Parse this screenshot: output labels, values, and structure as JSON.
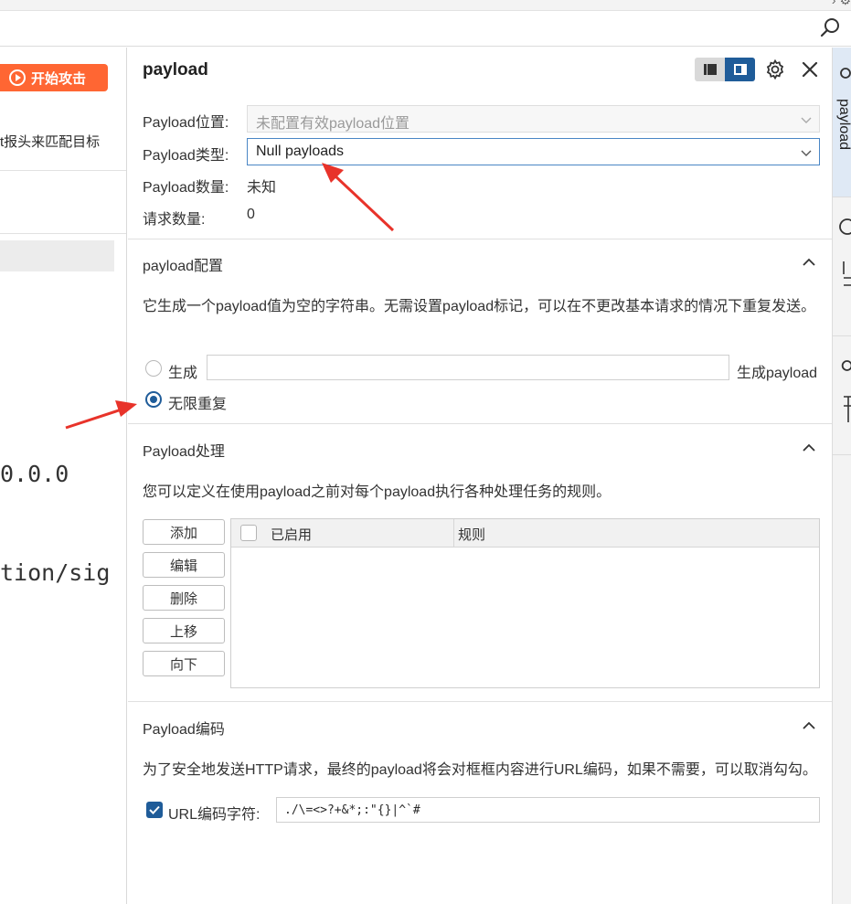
{
  "colors": {
    "accent": "#1f5c99",
    "attack": "#ff6633",
    "arrow": "#e8332a"
  },
  "left": {
    "attack_button": "开始攻击",
    "partial_text": "t报头来匹配目标",
    "mono_line1": "0.0.0",
    "mono_line2": "tion/sig"
  },
  "panel": {
    "title": "payload",
    "payload_position_label": "Payload位置:",
    "payload_position_value": "未配置有效payload位置",
    "payload_type_label": "Payload类型:",
    "payload_type_value": "Null payloads",
    "payload_count_label": "Payload数量:",
    "payload_count_value": "未知",
    "request_count_label": "请求数量:",
    "request_count_value": "0"
  },
  "config": {
    "title": "payload配置",
    "description": "它生成一个payload值为空的字符串。无需设置payload标记，可以在不更改基本请求的情况下重复发送。",
    "generate_label": "生成",
    "generate_value": "",
    "generate_suffix": "生成payload",
    "infinite_label": "无限重复"
  },
  "processing": {
    "title": "Payload处理",
    "description": "您可以定义在使用payload之前对每个payload执行各种处理任务的规则。",
    "buttons": [
      "添加",
      "编辑",
      "删除",
      "上移",
      "向下"
    ],
    "columns": [
      "已启用",
      "规则"
    ]
  },
  "encoding": {
    "title": "Payload编码",
    "description": "为了安全地发送HTTP请求，最终的payload将会对框框内容进行URL编码，如果不需要，可以取消勾勾。",
    "url_encode_label": "URL编码字符:",
    "url_encode_value": "./\\=<>?+&*;:\"{}|^`#"
  },
  "right_tabs": [
    "payload"
  ],
  "icons": [
    "search-icon",
    "gear-icon",
    "close-icon",
    "chevron-down-icon",
    "chevron-up-icon",
    "play-icon",
    "list-view-icon",
    "panel-view-icon"
  ]
}
